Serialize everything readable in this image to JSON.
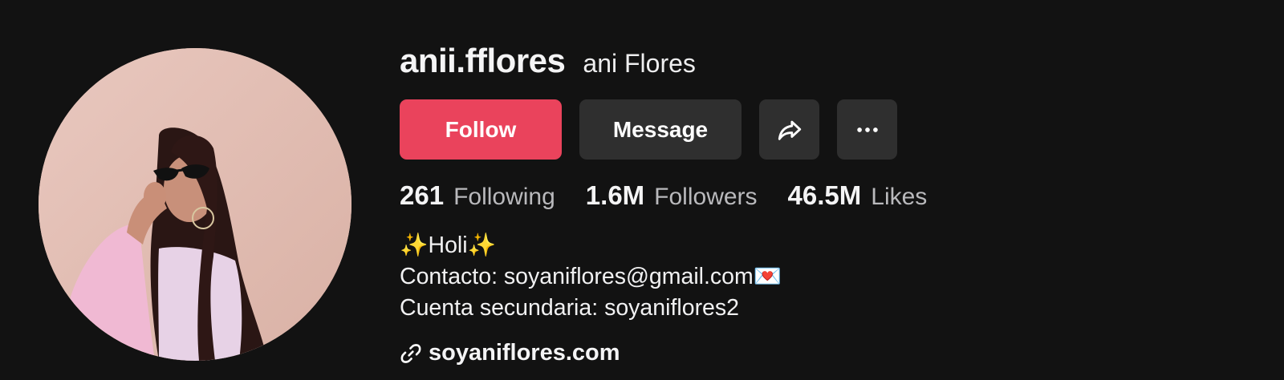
{
  "profile": {
    "username": "anii.fflores",
    "nickname": "ani Flores"
  },
  "buttons": {
    "follow": "Follow",
    "message": "Message",
    "share_icon": "share-arrow-icon",
    "more_icon": "more-dots-icon"
  },
  "stats": [
    {
      "value": "261",
      "label": "Following"
    },
    {
      "value": "1.6M",
      "label": "Followers"
    },
    {
      "value": "46.5M",
      "label": "Likes"
    }
  ],
  "bio": {
    "line1": "✨Holi✨",
    "line2": "Contacto: soyaniflores@gmail.com💌",
    "line3": "Cuenta secundaria: soyaniflores2"
  },
  "link": {
    "text": "soyaniflores.com",
    "icon": "link-icon"
  },
  "colors": {
    "background": "#121212",
    "follow": "#ea435c",
    "secondary_button": "#2f2f2f"
  }
}
